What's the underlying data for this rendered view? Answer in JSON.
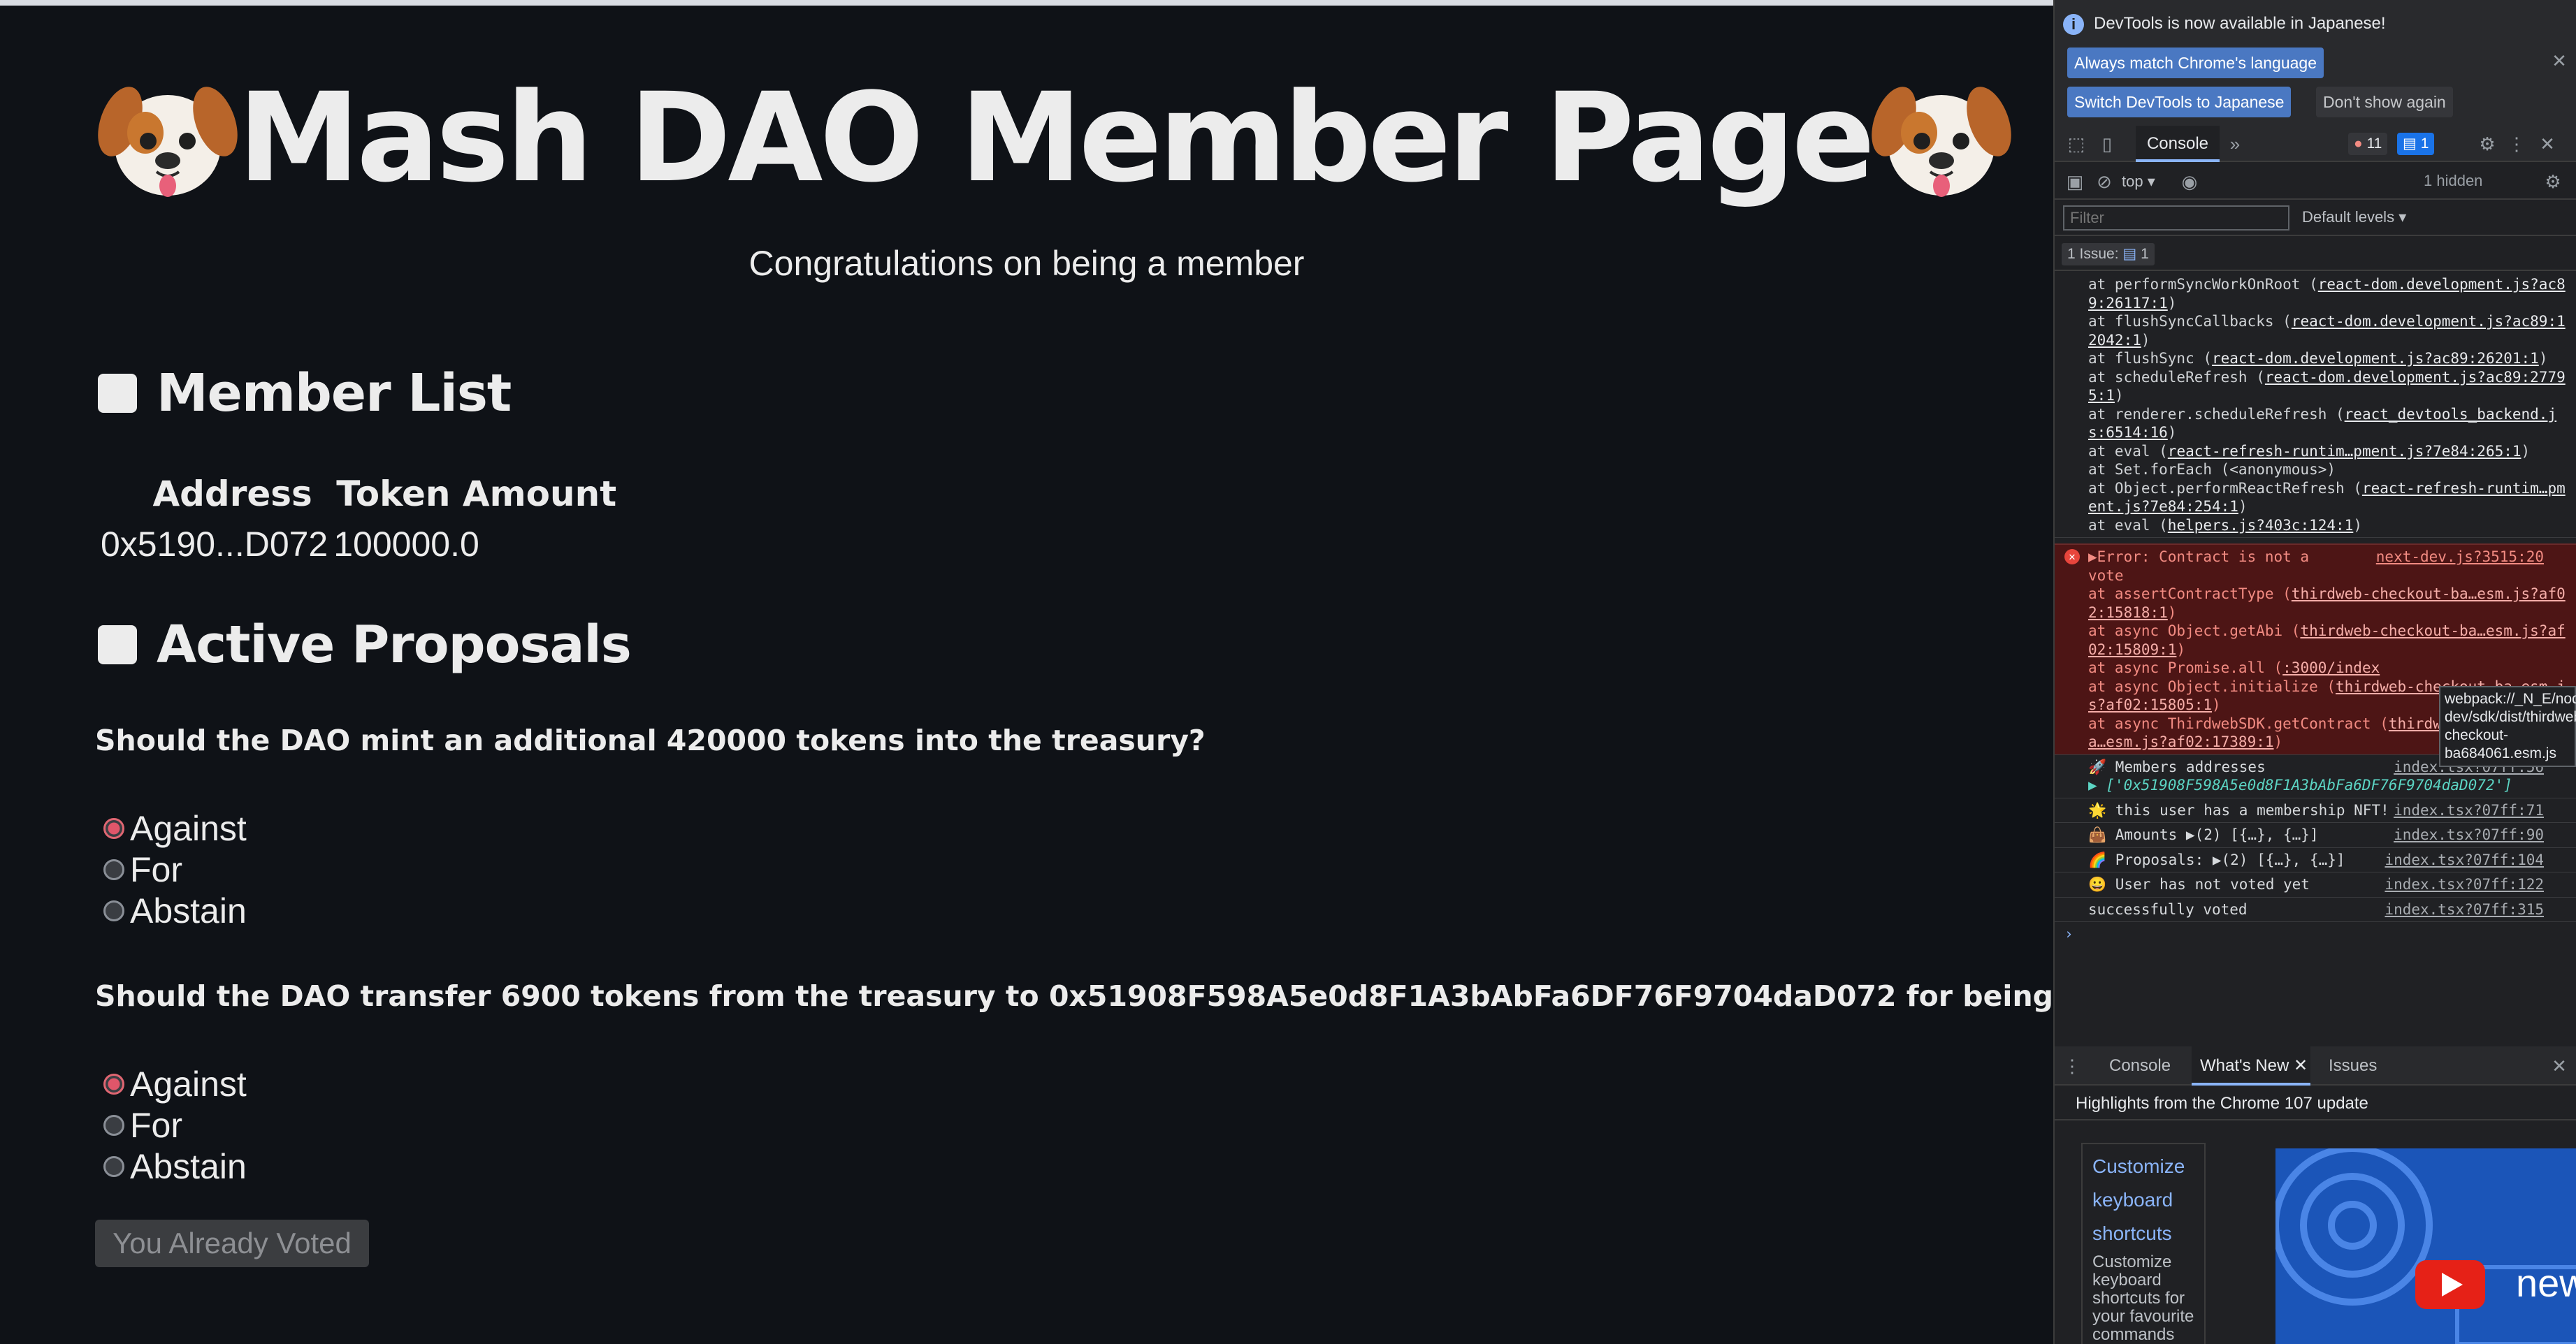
{
  "app": {
    "title": "Mash DAO Member Page",
    "subtitle": "Congratulations on being a member",
    "member_list": {
      "heading": "Member List",
      "columns": [
        "Address",
        "Token Amount"
      ],
      "rows": [
        {
          "address": "0x5190...D072",
          "amount": "100000.0"
        }
      ]
    },
    "proposals": {
      "heading": "Active Proposals",
      "items": [
        {
          "question": "Should the DAO mint an additional 420000 tokens into the treasury?",
          "options": [
            "Against",
            "For",
            "Abstain"
          ],
          "selected": "Against"
        },
        {
          "question": "Should the DAO transfer 6900 tokens from the treasury to 0x51908F598A5e0d8F1A3bAbFa6DF76F9704daD072 for being awesome?",
          "options": [
            "Against",
            "For",
            "Abstain"
          ],
          "selected": "Against"
        }
      ]
    },
    "vote_button": "You Already Voted"
  },
  "devtools": {
    "info_banner": "DevTools is now available in Japanese!",
    "always_match": "Always match Chrome's language",
    "switch_japanese": "Switch DevTools to Japanese",
    "dont_show": "Don't show again",
    "tab_console": "Console",
    "errors_count": "11",
    "messages_count": "1",
    "context": "top",
    "hidden": "1 hidden",
    "filter_placeholder": "Filter",
    "levels": "Default levels",
    "issues_label": "1 Issue:",
    "issues_count": "1",
    "stack_top": [
      {
        "text": "at performSyncWorkOnRoot (",
        "link": "react-dom.development.js?ac89:26117:1",
        "end": ")"
      },
      {
        "text": "at flushSyncCallbacks (",
        "link": "react-dom.development.js?ac89:12042:1",
        "end": ")"
      },
      {
        "text": "at flushSync (",
        "link": "react-dom.development.js?ac89:26201:1",
        "end": ")"
      },
      {
        "text": "at scheduleRefresh (",
        "link": "react-dom.development.js?ac89:27795:1",
        "end": ")"
      },
      {
        "text": "at renderer.scheduleRefresh (",
        "link": "react_devtools_backend.js:6514:16",
        "end": ")"
      },
      {
        "text": "at eval (",
        "link": "react-refresh-runtim…pment.js?7e84:265:1",
        "end": ")"
      },
      {
        "text": "at Set.forEach (<anonymous>)",
        "link": "",
        "end": ""
      },
      {
        "text": "at Object.performReactRefresh (",
        "link": "react-refresh-runtim…pment.js?7e84:254:1",
        "end": ")"
      },
      {
        "text": "at eval (",
        "link": "helpers.js?403c:124:1",
        "end": ")"
      }
    ],
    "error": {
      "message": "▶Error: Contract is not a vote",
      "source": "next-dev.js?3515:20",
      "stack": [
        {
          "text": "at assertContractType (",
          "link": "thirdweb-checkout-ba…esm.js?af02:15818:1",
          "end": ")"
        },
        {
          "text": "at async Object.getAbi (",
          "link": "thirdweb-checkout-ba…esm.js?af02:15809:1",
          "end": ")"
        },
        {
          "text": "at async Promise.all (",
          "link": ":3000/index",
          "end": ""
        },
        {
          "text": "at async Object.initialize (",
          "link": "thirdweb-checkout-ba…esm.js?af02:15805:1",
          "end": ")"
        },
        {
          "text": "at async ThirdwebSDK.getContract (",
          "link": "thirdweb-checkout-ba…esm.js?af02:17389:1",
          "end": ")"
        }
      ],
      "tooltip": "webpack://_N_E/node_modules/@thirdweb-dev/sdk/dist/thirdweb-checkout-ba684061.esm.js"
    },
    "logs": [
      {
        "text": "🚀 Members addresses",
        "sub": "▶ ['0x51908F598A5e0d8F1A3bAbFa6DF76F9704daD072']",
        "source": "index.tsx?07ff:56"
      },
      {
        "text": "🌟 this user has a membership NFT!",
        "sub": "",
        "source": "index.tsx?07ff:71"
      },
      {
        "text": "👜 Amounts ▶(2) [{…}, {…}]",
        "sub": "",
        "source": "index.tsx?07ff:90"
      },
      {
        "text": "🌈 Proposals: ▶(2) [{…}, {…}]",
        "sub": "",
        "source": "index.tsx?07ff:104"
      },
      {
        "text": "😀 User has not voted yet",
        "sub": "",
        "source": "index.tsx?07ff:122"
      },
      {
        "text": "successfully voted",
        "sub": "",
        "source": "index.tsx?07ff:315"
      }
    ],
    "drawer_tabs": [
      "Console",
      "What's New",
      "Issues"
    ],
    "whats_new_header": "Highlights from the Chrome 107 update",
    "customize_title": "Customize keyboard shortcuts",
    "customize_desc": "Customize keyboard shortcuts for your favourite commands",
    "video_text": "new"
  }
}
